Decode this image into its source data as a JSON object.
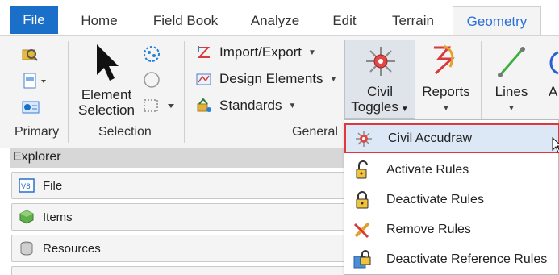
{
  "tabs": {
    "file": "File",
    "home": "Home",
    "field_book": "Field Book",
    "analyze": "Analyze",
    "edit": "Edit",
    "terrain": "Terrain",
    "geometry": "Geometry"
  },
  "ribbon": {
    "groups": {
      "primary": "Primary",
      "selection": "Selection",
      "general": "General"
    },
    "element_selection": {
      "line1": "Element",
      "line2": "Selection"
    },
    "general_cmds": {
      "import_export": "Import/Export",
      "design_elements": "Design Elements",
      "standards": "Standards"
    },
    "civil_toggles": {
      "line1": "Civil",
      "line2": "Toggles"
    },
    "reports": "Reports",
    "lines": "Lines",
    "partial": "A"
  },
  "explorer": {
    "title": "Explorer",
    "rows": [
      "File",
      "Items",
      "Resources"
    ]
  },
  "menu": {
    "items": [
      "Civil Accudraw",
      "Activate Rules",
      "Deactivate Rules",
      "Remove Rules",
      "Deactivate Reference Rules"
    ]
  },
  "colors": {
    "file_tab": "#1a6fc9",
    "active_tab_text": "#2a6fd6",
    "highlight_border": "#e0373f",
    "highlight_fill": "#dce8f5"
  }
}
